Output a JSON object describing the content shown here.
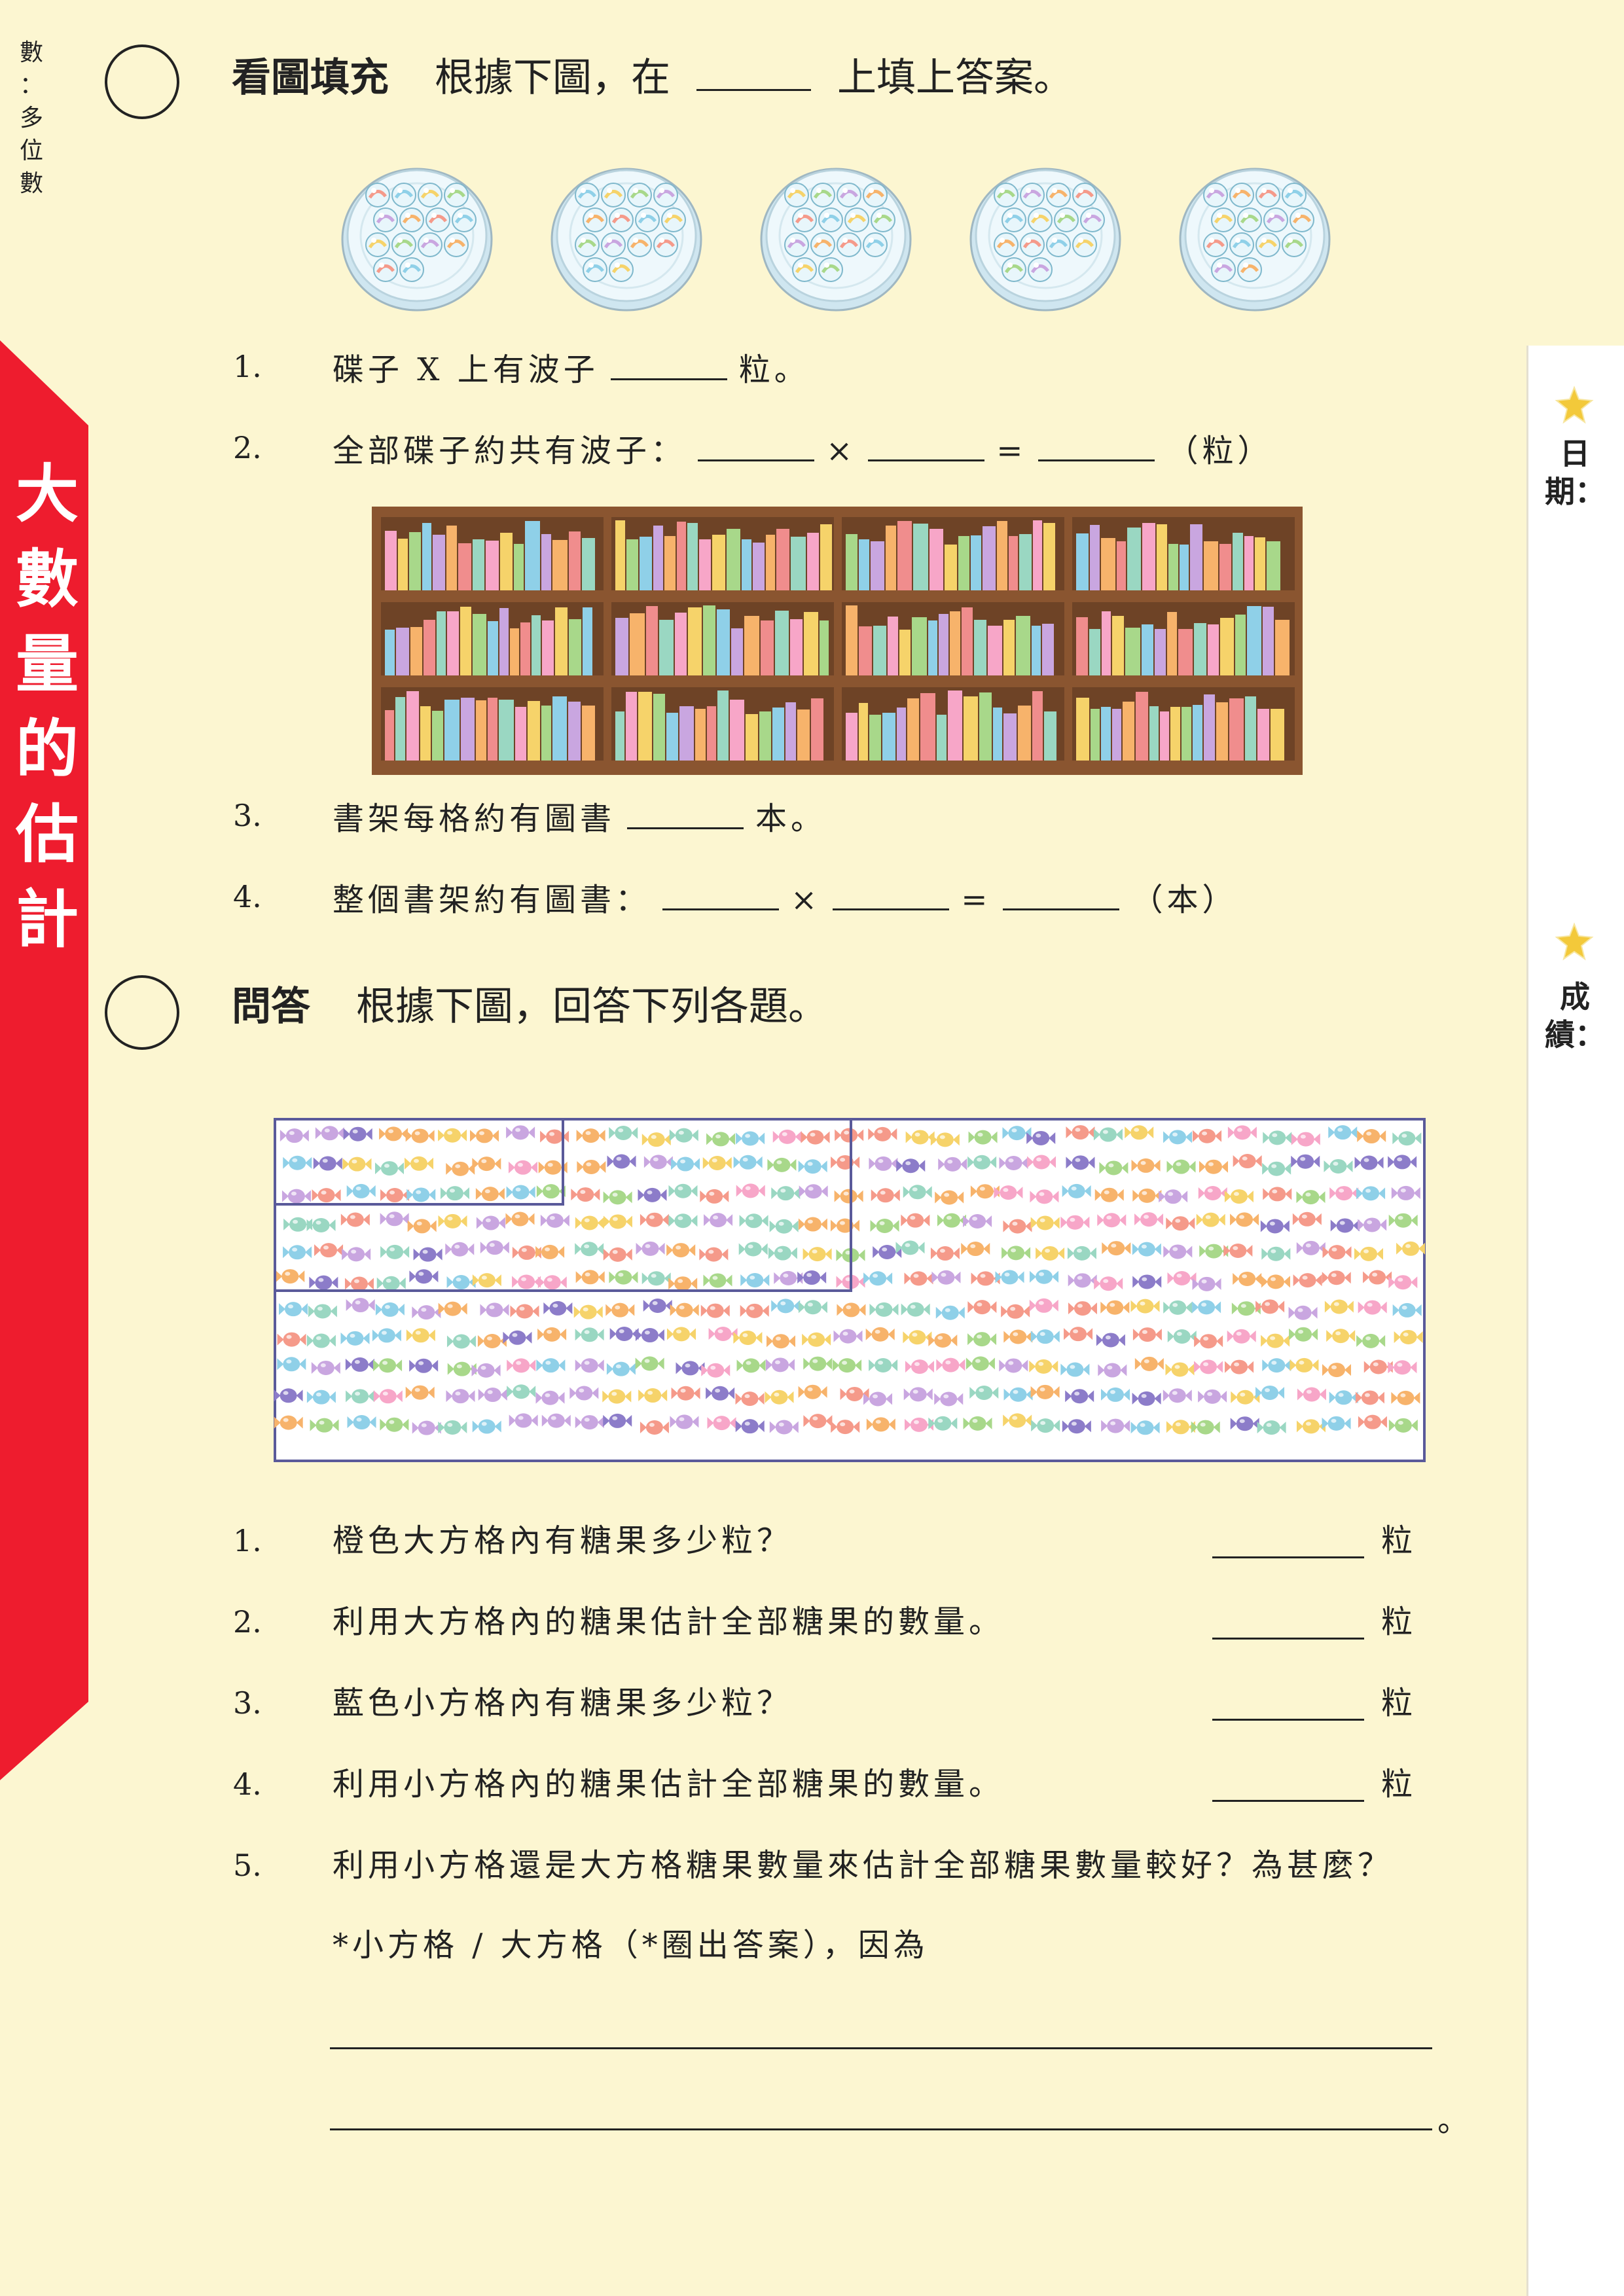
{
  "side_tab": {
    "text": "數：多位數"
  },
  "chapter_title": {
    "chars": [
      "大",
      "數",
      "量",
      "的",
      "估",
      "計"
    ]
  },
  "right_margin": {
    "date_label": "日期：",
    "score_label": "成績："
  },
  "section1": {
    "heading_bold": "看圖填充",
    "instruction_before": "根據下圖，在",
    "instruction_after": "上填上答案。",
    "plate_label": "X",
    "questions": [
      {
        "num": "1.",
        "before": "碟子 X 上有波子",
        "after": "粒。"
      },
      {
        "num": "2.",
        "before": "全部碟子約共有波子：",
        "times": "×",
        "equals": "=",
        "unit": "（粒）"
      },
      {
        "num": "3.",
        "before": "書架每格約有圖書",
        "after": "本。"
      },
      {
        "num": "4.",
        "before": "整個書架約有圖書：",
        "times": "×",
        "equals": "=",
        "unit": "（本）"
      }
    ]
  },
  "section2": {
    "heading_bold": "問答",
    "instruction": "根據下圖，回答下列各題。",
    "questions": [
      {
        "num": "1.",
        "text": "橙色大方格內有糖果多少粒？",
        "unit": "粒"
      },
      {
        "num": "2.",
        "text": "利用大方格內的糖果估計全部糖果的數量。",
        "unit": "粒"
      },
      {
        "num": "3.",
        "text": "藍色小方格內有糖果多少粒？",
        "unit": "粒"
      },
      {
        "num": "4.",
        "text": "利用小方格內的糖果估計全部糖果的數量。",
        "unit": "粒"
      },
      {
        "num": "5.",
        "text": "利用小方格還是大方格糖果數量來估計全部糖果數量較好？為甚麼？"
      }
    ],
    "q5_choice": "*小方格 / 大方格（*圈出答案），因為",
    "q5_end": "。"
  },
  "colors": {
    "red_tab": "#ee1c2e",
    "background": "#fcf6d1",
    "shelf_wood": "#8a5530",
    "candy_box_border": "#5a5a9a"
  }
}
